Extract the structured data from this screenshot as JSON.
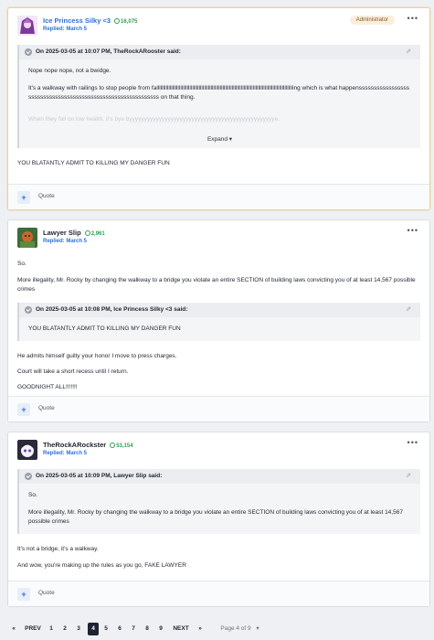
{
  "posts": [
    {
      "username": "Ice Princess Silky <3",
      "reputation": "16,075",
      "replied": "Replied: March 5",
      "badge": "Administrator",
      "quote": {
        "header": "On 2025-03-05 at 10:07 PM, TheRockARooster said:",
        "lines": [
          "Nope nope nope, not a bwidge.",
          "It's a walkway with railings to stop people from fallllllllllllllllllllllllllllllllllllllllllllllllllllllllllllllllllllllllllllllllllllllllllllllllllllllling which is what happensssssssssssssssssssssssssssssssssssssssssssssssssssssssssssss on that thing.",
          "When they fall on low health, it's bye byyyyyyyyyyyyyyyyyyyyyyyyyyyyyyyyyyyyyyyyyyyyyyyyye."
        ],
        "expand_label": "Expand"
      },
      "text": [
        "YOU BLATANTLY ADMIT TO KILLING MY DANGER FUN"
      ],
      "quote_label": "Quote"
    },
    {
      "username": "Lawyer Slip",
      "reputation": "2,961",
      "replied": "Replied: March 5",
      "pre_text": [
        "So.",
        "More illegality, Mr. Rocky by changing the walkway to a bridge you violate an entire SECTION of building laws convicting you of at least 14,567 possible crimes"
      ],
      "quote": {
        "header": "On 2025-03-05 at 10:08 PM, Ice Princess Silky <3 said:",
        "lines": [
          "YOU BLATANTLY ADMIT TO KILLING MY DANGER FUN"
        ]
      },
      "text": [
        "He admits himself guilty your honor I move to press charges.",
        "Court will take a short recess until I return.",
        "GOODNIGHT ALL!!!!!!!"
      ],
      "quote_label": "Quote"
    },
    {
      "username": "TheRockARockster",
      "reputation": "53,154",
      "replied": "Replied: March 5",
      "quote": {
        "header": "On 2025-03-05 at 10:09 PM, Lawyer Slip said:",
        "lines": [
          "So.",
          "More illegality, Mr. Rocky by changing the walkway to a bridge you violate an entire SECTION of building laws convicting you of at least 14,567 possible crimes"
        ]
      },
      "text": [
        "It's not a bridge, it's a walkway.",
        "And wow, you're making up the rules as you go, FAKE LAWYER"
      ],
      "quote_label": "Quote"
    }
  ],
  "pagination": {
    "first": "«",
    "prev": "PREV",
    "pages": [
      "1",
      "2",
      "3",
      "4",
      "5",
      "6",
      "7",
      "8",
      "9"
    ],
    "current": "4",
    "next": "NEXT",
    "last": "»",
    "info": "Page 4 of 9"
  },
  "colors": {
    "accent": "#2e6fd8",
    "reputation": "#2f9e4f",
    "badge_bg": "#fbeedc"
  }
}
